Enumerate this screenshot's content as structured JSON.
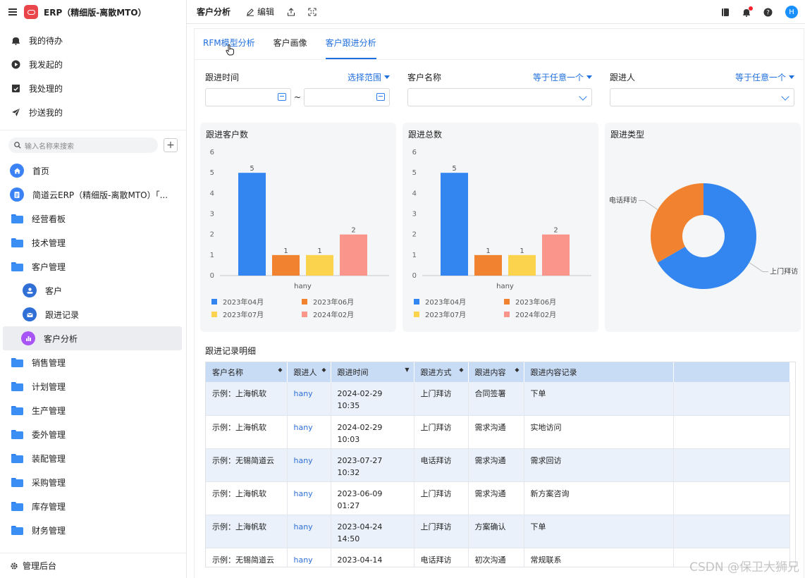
{
  "app": {
    "title": "ERP（精细版-离散MTO）"
  },
  "quick_items": [
    {
      "label": "我的待办",
      "icon": "bell-icon"
    },
    {
      "label": "我发起的",
      "icon": "play-icon"
    },
    {
      "label": "我处理的",
      "icon": "check-box-icon"
    },
    {
      "label": "抄送我的",
      "icon": "send-icon"
    }
  ],
  "search": {
    "placeholder": "输入名称来搜索",
    "add": "+"
  },
  "nav": [
    {
      "label": "首页",
      "icon": "home-icon"
    },
    {
      "label": "简道云ERP（精细版-离散MTO）「...",
      "icon": "doc-icon"
    },
    {
      "label": "经营看板",
      "icon": "folder-icon"
    },
    {
      "label": "技术管理",
      "icon": "folder-icon"
    },
    {
      "label": "客户管理",
      "icon": "folder-open-icon"
    },
    {
      "label": "客户",
      "icon": "user-icon"
    },
    {
      "label": "跟进记录",
      "icon": "mail-icon"
    },
    {
      "label": "客户分析",
      "icon": "bar-chart-icon"
    },
    {
      "label": "销售管理",
      "icon": "folder-icon"
    },
    {
      "label": "计划管理",
      "icon": "folder-icon"
    },
    {
      "label": "生产管理",
      "icon": "folder-icon"
    },
    {
      "label": "委外管理",
      "icon": "folder-icon"
    },
    {
      "label": "装配管理",
      "icon": "folder-icon"
    },
    {
      "label": "采购管理",
      "icon": "folder-icon"
    },
    {
      "label": "库存管理",
      "icon": "folder-icon"
    },
    {
      "label": "财务管理",
      "icon": "folder-icon"
    }
  ],
  "footer": {
    "label": "管理后台"
  },
  "topbar": {
    "title": "客户分析",
    "edit": "编辑",
    "avatar": "H"
  },
  "tabs": [
    "RFM模型分析",
    "客户画像",
    "客户跟进分析"
  ],
  "filters": {
    "time": {
      "label": "跟进时间",
      "op": "选择范围",
      "sep": "~"
    },
    "customer": {
      "label": "客户名称",
      "op": "等于任意一个"
    },
    "person": {
      "label": "跟进人",
      "op": "等于任意一个"
    }
  },
  "colors": {
    "blue": "#3385f0",
    "orange": "#f08230",
    "yellow": "#fcd34d",
    "salmon": "#f9958a",
    "accent": "#1f6fde"
  },
  "chart_data": [
    {
      "type": "bar",
      "title": "跟进客户数",
      "categories": [
        "hany"
      ],
      "series": [
        {
          "name": "2023年04月",
          "values": [
            5
          ]
        },
        {
          "name": "2023年06月",
          "values": [
            1
          ]
        },
        {
          "name": "2023年07月",
          "values": [
            1
          ]
        },
        {
          "name": "2024年02月",
          "values": [
            2
          ]
        }
      ],
      "ylim": [
        0,
        6
      ],
      "yticks": [
        0,
        1,
        2,
        3,
        4,
        5,
        6
      ]
    },
    {
      "type": "bar",
      "title": "跟进总数",
      "categories": [
        "hany"
      ],
      "series": [
        {
          "name": "2023年04月",
          "values": [
            5
          ]
        },
        {
          "name": "2023年06月",
          "values": [
            1
          ]
        },
        {
          "name": "2023年07月",
          "values": [
            1
          ]
        },
        {
          "name": "2024年02月",
          "values": [
            2
          ]
        }
      ],
      "ylim": [
        0,
        6
      ],
      "yticks": [
        0,
        1,
        2,
        3,
        4,
        5,
        6
      ]
    },
    {
      "type": "pie",
      "title": "跟进类型",
      "slices": [
        {
          "label": "上门拜访",
          "value": 4
        },
        {
          "label": "电话拜访",
          "value": 2
        }
      ]
    }
  ],
  "detail": {
    "title": "跟进记录明细",
    "columns": [
      "客户名称",
      "跟进人",
      "跟进时间",
      "跟进方式",
      "跟进内容",
      "跟进内容记录"
    ],
    "rows": [
      [
        "示例：上海帆软",
        "hany",
        "2024-02-29 10:35",
        "上门拜访",
        "合同签署",
        "下单"
      ],
      [
        "示例：上海帆软",
        "hany",
        "2024-02-29 10:03",
        "上门拜访",
        "需求沟通",
        "实地访问"
      ],
      [
        "示例：无锡简道云",
        "hany",
        "2023-07-27 10:32",
        "电话拜访",
        "需求沟通",
        "需求回访"
      ],
      [
        "示例：上海帆软",
        "hany",
        "2023-06-09 01:27",
        "上门拜访",
        "需求沟通",
        "新方案咨询"
      ],
      [
        "示例：上海帆软",
        "hany",
        "2023-04-24 14:50",
        "上门拜访",
        "方案确认",
        "下单"
      ],
      [
        "示例：无锡简道云",
        "hany",
        "2023-04-14",
        "电话拜访",
        "初次沟通",
        "常规联系"
      ]
    ]
  },
  "watermark": "CSDN @保卫大狮兄"
}
